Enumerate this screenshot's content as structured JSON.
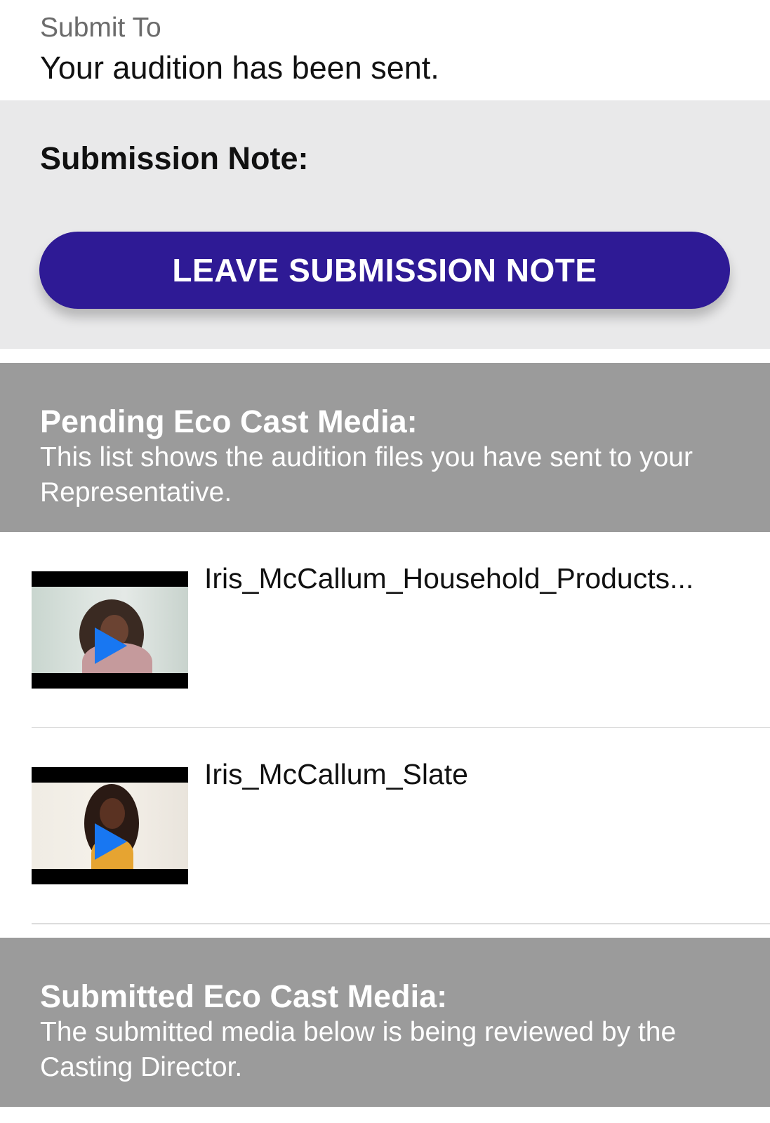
{
  "header": {
    "label": "Submit To",
    "status": "Your audition has been sent."
  },
  "submission_note": {
    "title": "Submission Note:",
    "button_label": "LEAVE SUBMISSION NOTE",
    "button_color": "#2e1a95"
  },
  "pending": {
    "title": "Pending Eco Cast Media:",
    "description": "This list shows the audition files you have sent to your Representative.",
    "items": [
      {
        "name": "Iris_McCallum_Household_Products...",
        "icon": "play-icon"
      },
      {
        "name": "Iris_McCallum_Slate",
        "icon": "play-icon"
      }
    ]
  },
  "submitted": {
    "title": "Submitted Eco Cast Media:",
    "description": "The submitted media below is being reviewed by the Casting Director."
  },
  "colors": {
    "section_gray": "#9b9b9b",
    "note_bg": "#e9e9ea",
    "play_blue": "#1877f2"
  }
}
